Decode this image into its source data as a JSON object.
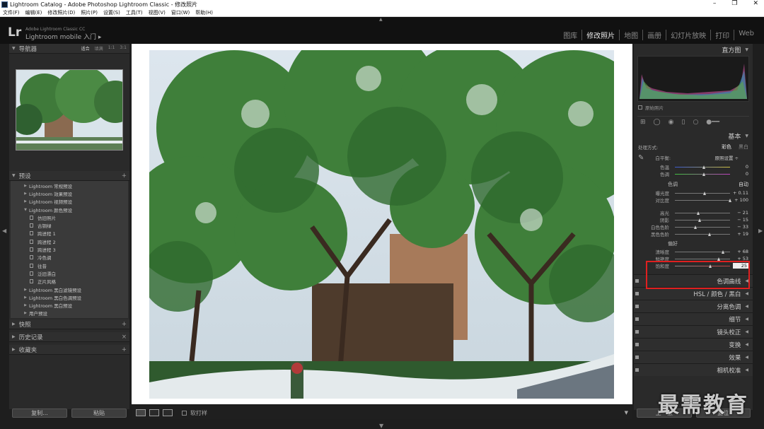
{
  "window": {
    "title": "Lightroom Catalog - Adobe Photoshop Lightroom Classic - 修改照片",
    "controls": [
      "–",
      "❐",
      "✕"
    ]
  },
  "menu": [
    "文件(F)",
    "编辑(E)",
    "修改照片(D)",
    "照片(P)",
    "设置(S)",
    "工具(T)",
    "视图(V)",
    "窗口(W)",
    "帮助(H)"
  ],
  "identity": {
    "logo": "Lr",
    "product": "Adobe Lightroom Classic CC",
    "mobile": "Lightroom mobile 入门 ▸"
  },
  "modules": [
    {
      "label": "图库",
      "active": false
    },
    {
      "label": "修改照片",
      "active": true
    },
    {
      "label": "地图",
      "active": false
    },
    {
      "label": "画册",
      "active": false
    },
    {
      "label": "幻灯片放映",
      "active": false
    },
    {
      "label": "打印",
      "active": false
    },
    {
      "label": "Web",
      "active": false
    }
  ],
  "navigator": {
    "title": "导航器",
    "options": [
      "适合",
      "填满",
      "1:1",
      "3:1"
    ],
    "selected": "适合"
  },
  "presets": {
    "title": "预设",
    "add": "+",
    "items": [
      {
        "label": "Lightroom 常规预设",
        "level": 0,
        "expanded": false
      },
      {
        "label": "Lightroom 效果预设",
        "level": 0,
        "expanded": false
      },
      {
        "label": "Lightroom 视频预设",
        "level": 0,
        "expanded": false
      },
      {
        "label": "Lightroom 颜色预设",
        "level": 0,
        "expanded": true
      },
      {
        "label": "仿旧照片",
        "level": 1
      },
      {
        "label": "古铜绿",
        "level": 1
      },
      {
        "label": "跨进程 1",
        "level": 1
      },
      {
        "label": "跨进程 2",
        "level": 1
      },
      {
        "label": "跨进程 3",
        "level": 1
      },
      {
        "label": "冷色调",
        "level": 1
      },
      {
        "label": "往昔",
        "level": 1
      },
      {
        "label": "泛旧漂白",
        "level": 1
      },
      {
        "label": "正片风格",
        "level": 1
      },
      {
        "label": "Lightroom 黑白滤镜预设",
        "level": 0,
        "expanded": false
      },
      {
        "label": "Lightroom 黑白色调预设",
        "level": 0,
        "expanded": false
      },
      {
        "label": "Lightroom 黑白预设",
        "level": 0,
        "expanded": false
      },
      {
        "label": "用户预设",
        "level": 0,
        "expanded": false
      }
    ]
  },
  "snapshots": {
    "title": "快照",
    "action": "+"
  },
  "history": {
    "title": "历史记录",
    "action": "×"
  },
  "collections": {
    "title": "收藏夹",
    "action": "+"
  },
  "leftButtons": {
    "copy": "复制...",
    "paste": "粘贴"
  },
  "toolbar": {
    "softproof": "软打样"
  },
  "histogram": {
    "title": "直方图",
    "original": "原始照片"
  },
  "basic": {
    "title": "基本",
    "treatment_label": "处理方式:",
    "treatment_color": "彩色",
    "treatment_bw": "黑白",
    "wb_label": "白平衡:",
    "wb_value": "原照设置 ÷",
    "temp": {
      "label": "色温",
      "value": "0",
      "pos": 0.5
    },
    "tint": {
      "label": "色调",
      "value": "0",
      "pos": 0.5
    },
    "tone_title": "色调",
    "auto": "自动",
    "exposure": {
      "label": "曝光度",
      "value": "+ 0.11",
      "pos": 0.51
    },
    "contrast": {
      "label": "对比度",
      "value": "+ 100",
      "pos": 1.0
    },
    "highlights": {
      "label": "高光",
      "value": "− 21",
      "pos": 0.4
    },
    "shadows": {
      "label": "阴影",
      "value": "− 15",
      "pos": 0.42
    },
    "whites": {
      "label": "白色色阶",
      "value": "− 33",
      "pos": 0.34
    },
    "blacks": {
      "label": "黑色色阶",
      "value": "+ 19",
      "pos": 0.6
    },
    "presence_title": "偏好",
    "clarity": {
      "label": "清晰度",
      "value": "+ 68",
      "pos": 0.84
    },
    "vibrance": {
      "label": "鲜艳度",
      "value": "+ 53",
      "pos": 0.77
    },
    "saturation": {
      "label": "饱和度",
      "value": "25",
      "pos": 0.62
    }
  },
  "sections": [
    {
      "name": "色调曲线"
    },
    {
      "name": "HSL / 颜色 / 黑白"
    },
    {
      "name": "分离色调"
    },
    {
      "name": "细节"
    },
    {
      "name": "镜头校正"
    },
    {
      "name": "变换"
    },
    {
      "name": "效果"
    },
    {
      "name": "相机校准"
    }
  ],
  "rightButtons": {
    "previous": "上一张",
    "reset": "复位"
  },
  "watermark": "最需教育"
}
